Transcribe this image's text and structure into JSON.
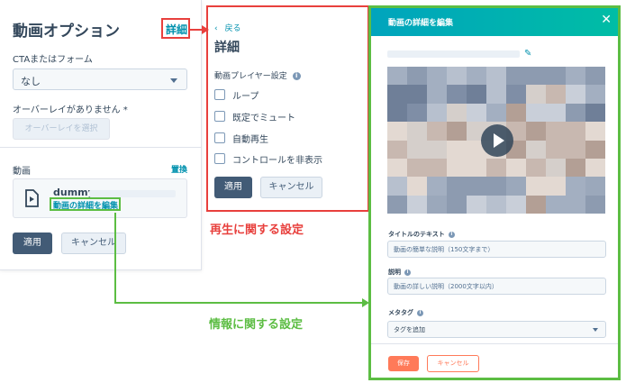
{
  "options_panel": {
    "title": "動画オプション",
    "detail_link": "詳細",
    "cta_label": "CTAまたはフォーム",
    "cta_value": "なし",
    "overlay_label": "オーバーレイがありません *",
    "overlay_button": "オーバーレイを選択",
    "video_label": "動画",
    "replace_link": "置換",
    "video_name": "dummy-",
    "edit_details_link": "動画の詳細を編集",
    "apply_button": "適用",
    "cancel_button": "キャンセル"
  },
  "detail_panel": {
    "back_link": "戻る",
    "title": "詳細",
    "section_label": "動画プレイヤー設定",
    "checkboxes": [
      {
        "label": "ループ",
        "checked": false
      },
      {
        "label": "既定でミュート",
        "checked": false
      },
      {
        "label": "自動再生",
        "checked": false
      },
      {
        "label": "コントロールを非表示",
        "checked": false
      }
    ],
    "apply_button": "適用",
    "cancel_button": "キャンセル"
  },
  "captions": {
    "playback": "再生に関する設定",
    "info": "情報に関する設定"
  },
  "edit_panel": {
    "title": "動画の詳細を編集",
    "title_text_label": "タイトルのテキスト",
    "title_text_placeholder": "動画の簡単な説明（150文字まで）",
    "description_label": "説明",
    "description_placeholder": "動画の詳しい説明（2000文字以内）",
    "meta_tag_label": "メタタグ",
    "meta_tag_value": "タグを追加",
    "save_button": "保存",
    "cancel_button": "キャンセル"
  },
  "colors": {
    "red_highlight": "#e8403d",
    "green_highlight": "#5cbd43",
    "link": "#0091ae",
    "primary_button": "#425b76",
    "save_button": "#ff7a59"
  },
  "icons": {
    "info": "info-circle-icon",
    "video": "video-file-icon",
    "play": "play-icon",
    "edit": "pencil-icon",
    "close": "close-icon"
  }
}
